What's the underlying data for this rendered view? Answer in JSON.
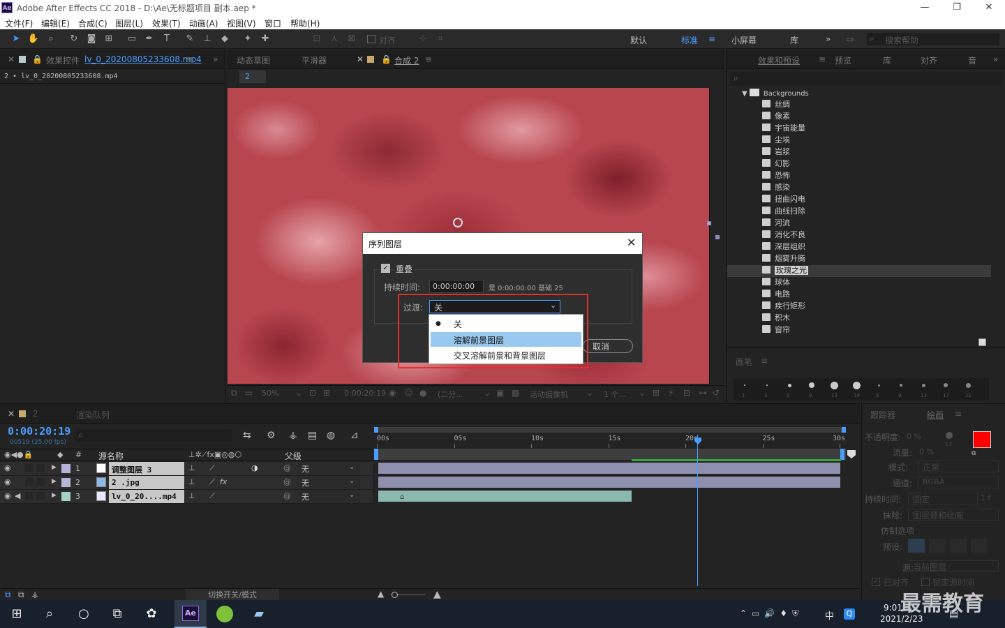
{
  "window": {
    "title": "Adobe After Effects CC 2018 - D:\\Ae\\无标题项目 副本.aep *",
    "logo": "Ae",
    "minimize": "—",
    "restore": "❐",
    "close": "✕"
  },
  "menu": [
    "文件(F)",
    "编辑(E)",
    "合成(C)",
    "图层(L)",
    "效果(T)",
    "动画(A)",
    "视图(V)",
    "窗口",
    "帮助(H)"
  ],
  "toolbar": {
    "align_label": "对齐",
    "workspaces": [
      "默认",
      "标准",
      "小屏幕",
      "库"
    ],
    "active_workspace": "标准",
    "search_placeholder": "搜索帮助"
  },
  "effect_controls": {
    "tab_label": "效果控件",
    "tab_file": "lv_0_20200805233608.mp4",
    "subtitle": "2 • lv_0_20200805233608.mp4"
  },
  "comp_panel": {
    "tabs": [
      "动态草图",
      "平滑器",
      "合成 2"
    ],
    "flow_label": "2",
    "zoom": "50%",
    "timecode": "0:00:20:19",
    "resolution": "(二分...",
    "camera": "活动摄像机",
    "views": "1 个..."
  },
  "right_panel": {
    "tabs": [
      "效果和预设",
      "预览",
      "库",
      "对齐",
      "音"
    ],
    "folder": "Backgrounds",
    "items": [
      "丝绸",
      "像素",
      "宇宙能量",
      "尘埃",
      "岩浆",
      "幻影",
      "恐怖",
      "感染",
      "扭曲闪电",
      "曲线扫除",
      "河流",
      "消化不良",
      "深层组织",
      "烟雾升腾",
      "玫瑰之光",
      "球体",
      "电路",
      "疾行矩形",
      "积木",
      "窗帘"
    ],
    "selected": "玫瑰之光"
  },
  "brushes": {
    "title": "画笔",
    "sizes": [
      "1",
      "3",
      "5",
      "9",
      "13",
      "19",
      "5",
      "9",
      "13",
      "17",
      "21"
    ]
  },
  "dialog": {
    "title": "序列图层",
    "close": "✕",
    "overlap_label": "重叠",
    "duration_label": "持续时间:",
    "duration_value": "0:00:00:00",
    "duration_note": "是 0:00:00:00 基础 25",
    "transition_label": "过渡:",
    "transition_value": "关",
    "options": [
      "关",
      "溶解前景图层",
      "交叉溶解前景和背景图层"
    ],
    "highlighted": "溶解前景图层",
    "cancel": "取消"
  },
  "timeline": {
    "tabs": [
      "2",
      "渲染队列"
    ],
    "timecode": "0:00:20:19",
    "sub": "00519 (25.00 fps)",
    "ruler": [
      "00s",
      "05s",
      "10s",
      "15s",
      "20s",
      "25s",
      "30s"
    ],
    "col_num": "#",
    "col_source": "源名称",
    "col_parent": "父级",
    "footer": "切换开关/模式",
    "layers": [
      {
        "num": "1",
        "name": "调整图层 3",
        "parent": "无"
      },
      {
        "num": "2",
        "name": "2 .jpg",
        "parent": "无"
      },
      {
        "num": "3",
        "name": "lv_0_20....mp4",
        "parent": "无"
      }
    ]
  },
  "paint": {
    "tabs": [
      "跟踪器",
      "绘画"
    ],
    "opacity_label": "不透明度:",
    "opacity": "0 %",
    "flow_label": "流量:",
    "flow": "0 %",
    "mode_label": "模式:",
    "mode": "正常",
    "channel_label": "通道:",
    "channel": "RGBA",
    "duration_label": "持续时间:",
    "duration": "固定",
    "frames": "1 f",
    "erase_label": "抹除:",
    "erase": "图层源和绘画",
    "clone_label": "仿制选项",
    "preset_label": "预设:",
    "source_label": "源:",
    "source": "当前图层",
    "aligned": "已对齐",
    "lock": "锁定源时间",
    "brush_num": "13"
  },
  "taskbar": {
    "time": "9:01",
    "date": "2021/2/23",
    "ime": "中",
    "watermark": "最需教育"
  }
}
